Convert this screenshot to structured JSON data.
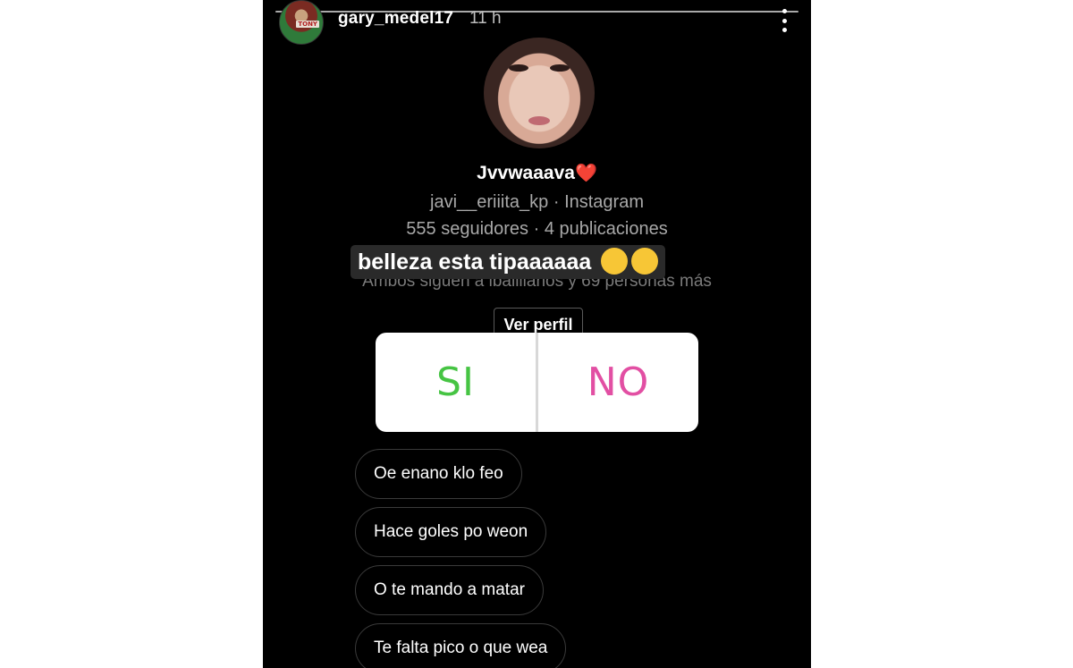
{
  "story": {
    "username": "gary_medel17",
    "time": "11 h",
    "avatar_tag": "TONY",
    "progress": 1.0,
    "more_icon": "more-vertical-icon"
  },
  "profile": {
    "display_name": "Jvvwaaava",
    "heart": "❤️",
    "handle_line": "javi__eriiita_kp · Instagram",
    "stats_line": "555 seguidores · 4 publicaciones",
    "mutual_line": "Ambos siguen a ibaillianos y 69 personas más",
    "view_profile_label": "Ver perfil"
  },
  "caption": {
    "text": "belleza esta tipaaaaaa",
    "emojis": [
      "😂",
      "🤪"
    ]
  },
  "poll": {
    "options": [
      "SI",
      "NO"
    ],
    "colors": {
      "yes": "#46c443",
      "no": "#e24fa3"
    }
  },
  "replies": [
    "Oe enano klo feo",
    "Hace goles po weon",
    "O te mando a matar",
    "Te falta pico o que wea"
  ]
}
